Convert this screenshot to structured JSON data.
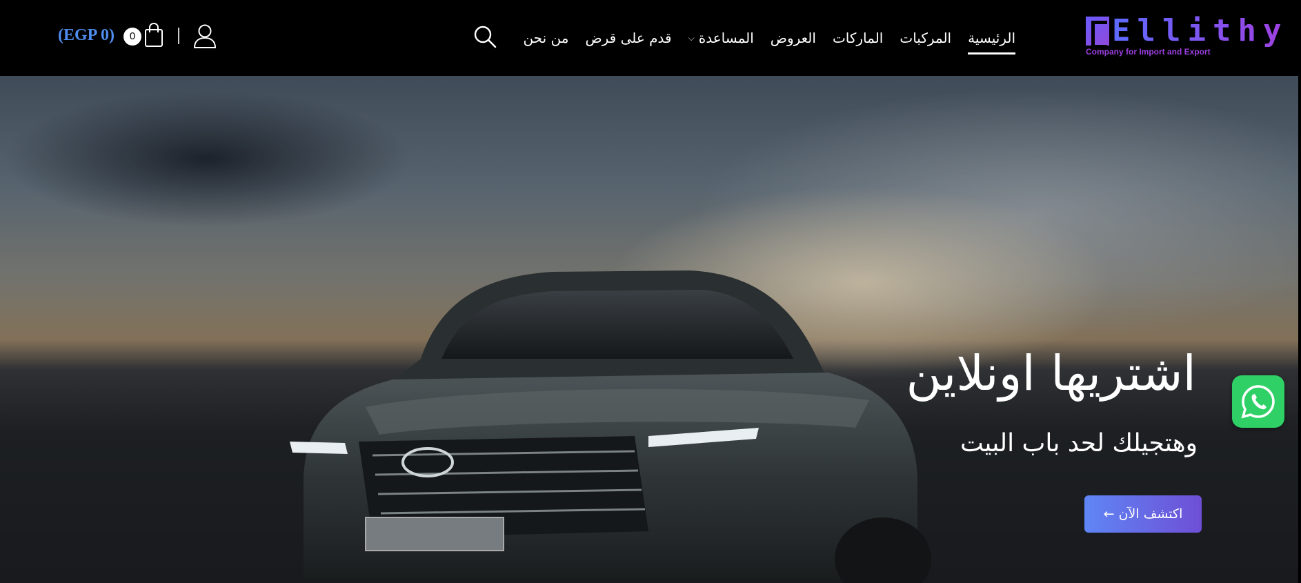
{
  "brand": {
    "wordmark": "Ellithy",
    "tagline": "Company for Import and Export",
    "colors": {
      "gradient_start": "#5d6bff",
      "gradient_end": "#a040e0"
    }
  },
  "nav": {
    "items": [
      {
        "label": "الرئيسية",
        "active": true
      },
      {
        "label": "المركبات",
        "active": false
      },
      {
        "label": "الماركات",
        "active": false
      },
      {
        "label": "العروض",
        "active": false
      },
      {
        "label": "المساعدة",
        "active": false,
        "has_dropdown": true
      },
      {
        "label": "قدم على قرض",
        "active": false
      },
      {
        "label": "من نحن",
        "active": false
      }
    ],
    "icons": {
      "search": "search-icon",
      "user": "user-icon",
      "cart": "shopping-bag-icon",
      "dropdown": "chevron-down-icon"
    }
  },
  "cart": {
    "count": "0",
    "total": "(EGP  0)"
  },
  "hero": {
    "title": "اشتريها اونلاين",
    "subtitle": "وهتجيلك لحد باب البيت",
    "cta_label": "اكتشف الآن ←"
  },
  "whatsapp": {
    "icon": "whatsapp-icon",
    "color": "#2fd166"
  }
}
